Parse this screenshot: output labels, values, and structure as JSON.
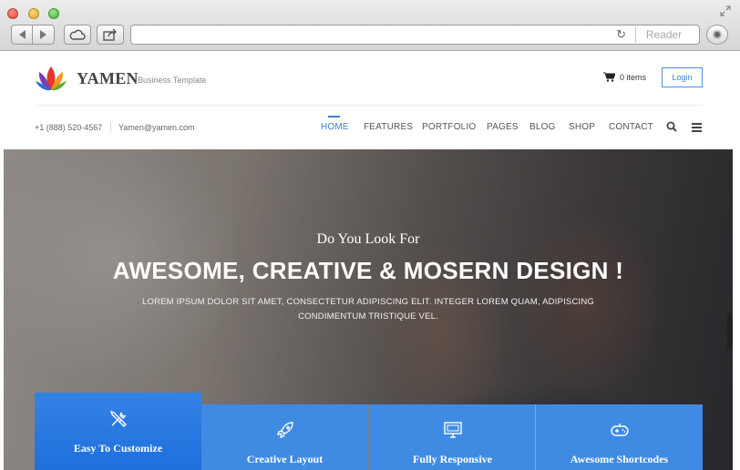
{
  "browser": {
    "reader_label": "Reader",
    "icons": [
      "back-icon",
      "forward-icon",
      "icloud-icon",
      "share-icon",
      "reload-icon",
      "download-icon",
      "fullscreen-icon"
    ]
  },
  "header": {
    "brand": "YAMEN",
    "tagline": "Business Template",
    "cart_label": "0 items",
    "login_label": "Login",
    "phone": "+1 (888) 520-4567",
    "email": "Yamen@yamen.com",
    "nav": [
      "HOME",
      "FEATURES",
      "PORTFOLIO",
      "PAGES",
      "BLOG",
      "SHOP",
      "CONTACT"
    ],
    "active_nav": "HOME"
  },
  "hero": {
    "pretitle": "Do You Look For",
    "title": "AWESOME, CREATIVE & MOSERN DESIGN !",
    "subtitle": "LOREM IPSUM DOLOR SIT AMET, CONSECTETUR ADIPISCING ELIT. INTEGER LOREM QUAM, ADIPISCING CONDIMENTUM TRISTIQUE VEL."
  },
  "features": [
    {
      "label": "Easy To Customize",
      "icon": "tools-icon",
      "active": true
    },
    {
      "label": "Creative Layout",
      "icon": "rocket-icon",
      "active": false
    },
    {
      "label": "Fully Responsive",
      "icon": "monitor-icon",
      "active": false
    },
    {
      "label": "Awesome Shortcodes",
      "icon": "gamepad-icon",
      "active": false
    }
  ],
  "colors": {
    "accent": "#3b82d8",
    "feature_bg": "#3f8be4",
    "feature_active_bg": "#2a7ae2"
  }
}
